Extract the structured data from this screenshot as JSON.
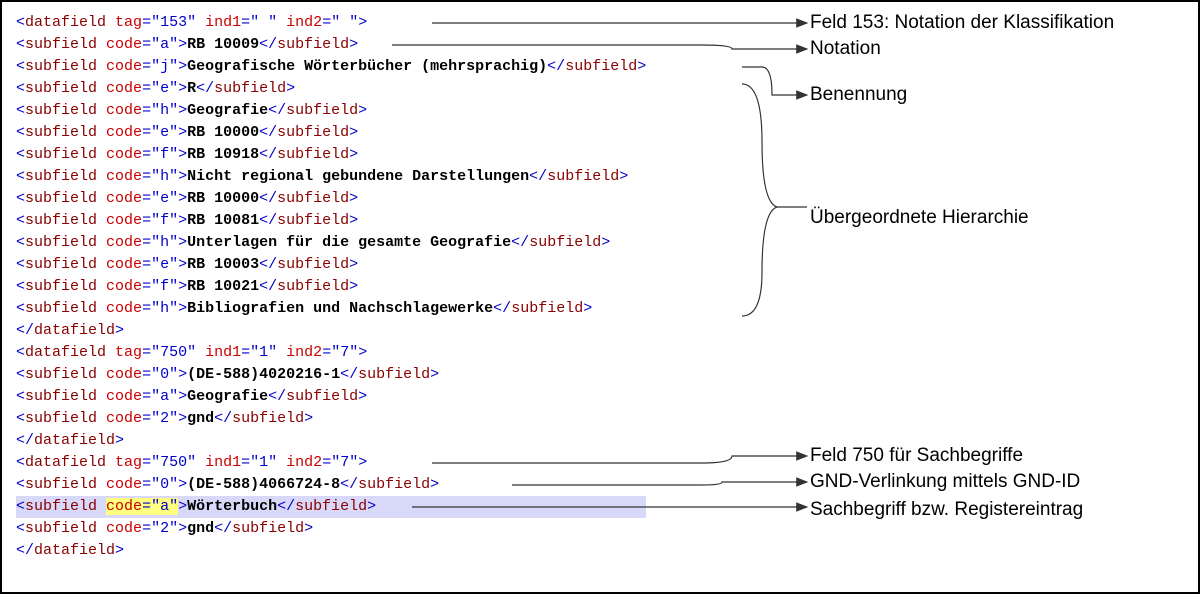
{
  "code": {
    "lines": [
      {
        "type": "open-datafield",
        "tag": "153",
        "ind1": " ",
        "ind2": " "
      },
      {
        "type": "subfield",
        "code": "a",
        "text": "RB 10009"
      },
      {
        "type": "subfield",
        "code": "j",
        "text": "Geografische Wörterbücher (mehrsprachig)"
      },
      {
        "type": "subfield",
        "code": "e",
        "text": "R"
      },
      {
        "type": "subfield",
        "code": "h",
        "text": "Geografie"
      },
      {
        "type": "subfield",
        "code": "e",
        "text": "RB 10000"
      },
      {
        "type": "subfield",
        "code": "f",
        "text": "RB 10918"
      },
      {
        "type": "subfield",
        "code": "h",
        "text": "Nicht regional gebundene Darstellungen"
      },
      {
        "type": "subfield",
        "code": "e",
        "text": "RB 10000"
      },
      {
        "type": "subfield",
        "code": "f",
        "text": "RB 10081"
      },
      {
        "type": "subfield",
        "code": "h",
        "text": "Unterlagen für die gesamte Geografie"
      },
      {
        "type": "subfield",
        "code": "e",
        "text": "RB 10003"
      },
      {
        "type": "subfield",
        "code": "f",
        "text": "RB 10021"
      },
      {
        "type": "subfield",
        "code": "h",
        "text": "Bibliografien und Nachschlagewerke"
      },
      {
        "type": "close-datafield"
      },
      {
        "type": "open-datafield",
        "tag": "750",
        "ind1": "1",
        "ind2": "7"
      },
      {
        "type": "subfield",
        "code": "0",
        "text": "(DE-588)4020216-1"
      },
      {
        "type": "subfield",
        "code": "a",
        "text": "Geografie"
      },
      {
        "type": "subfield",
        "code": "2",
        "text": "gnd"
      },
      {
        "type": "close-datafield"
      },
      {
        "type": "open-datafield",
        "tag": "750",
        "ind1": "1",
        "ind2": "7"
      },
      {
        "type": "subfield",
        "code": "0",
        "text": "(DE-588)4066724-8"
      },
      {
        "type": "subfield",
        "code": "a",
        "text": "Wörterbuch",
        "highlight": true
      },
      {
        "type": "subfield",
        "code": "2",
        "text": "gnd"
      },
      {
        "type": "close-datafield"
      }
    ]
  },
  "annotations": {
    "feld153": "Feld 153: Notation der Klassifikation",
    "notation": "Notation",
    "benennung": "Benennung",
    "hierarchie": "Übergeordnete Hierarchie",
    "feld750": "Feld 750 für Sachbegriffe",
    "gndlink": "GND-Verlinkung mittels GND-ID",
    "sachbegriff": "Sachbegriff bzw. Registereintrag"
  }
}
